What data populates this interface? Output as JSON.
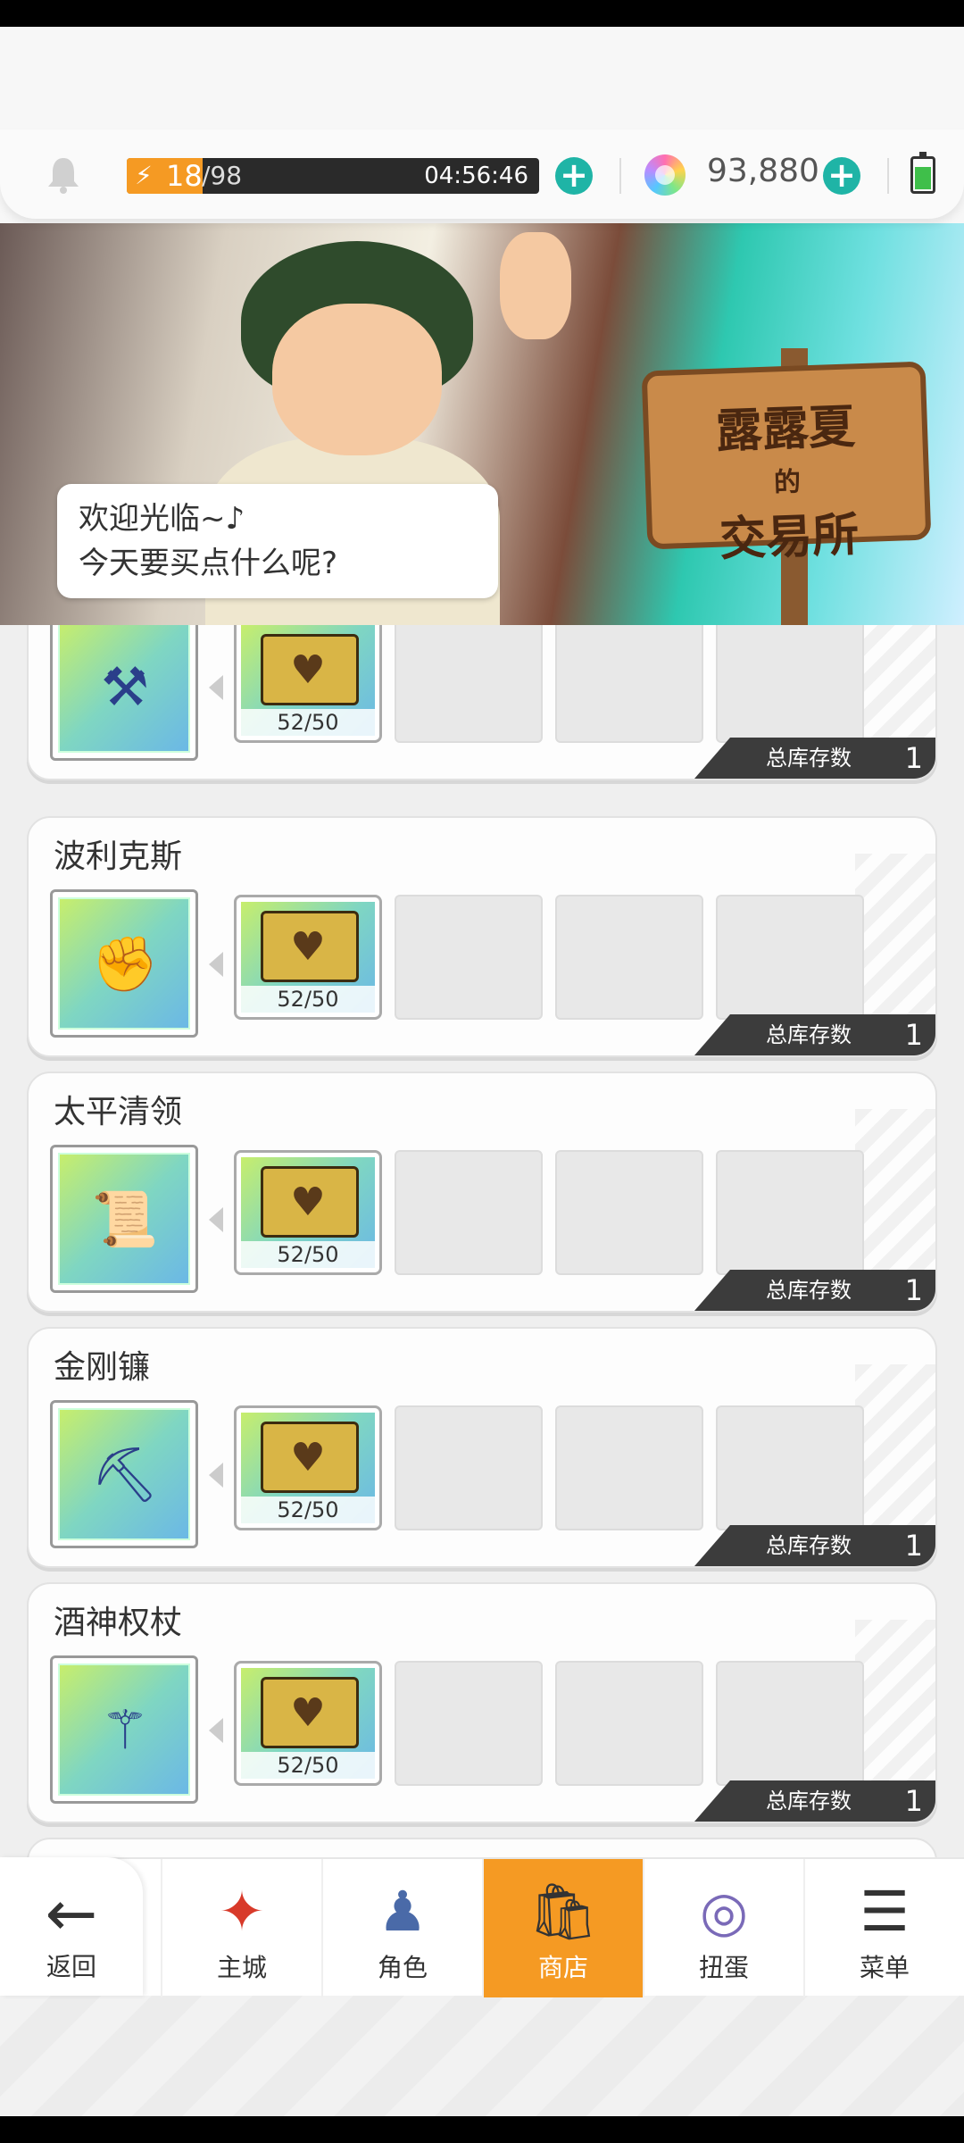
{
  "resources": {
    "energy_current": "18",
    "energy_max": "/98",
    "energy_fraction": 0.184,
    "energy_timer": "04:56:46",
    "gems": "93,880",
    "battery_level": 0.7
  },
  "banner": {
    "sign_line1": "露露夏",
    "sign_mid": "的",
    "sign_line2": "交易所",
    "greeting_line1": "欢迎光临~♪",
    "greeting_line2": "今天要买点什么呢?"
  },
  "shop_items": [
    {
      "name": "",
      "icon": "axe-icon",
      "glyph": "⚒",
      "material_count": "52/50",
      "stock_label": "总库存数",
      "stock": "1"
    },
    {
      "name": "波利克斯",
      "icon": "gauntlet-icon",
      "glyph": "✊",
      "material_count": "52/50",
      "stock_label": "总库存数",
      "stock": "1"
    },
    {
      "name": "太平清领",
      "icon": "scroll-icon",
      "glyph": "📜",
      "material_count": "52/50",
      "stock_label": "总库存数",
      "stock": "1"
    },
    {
      "name": "金刚镰",
      "icon": "scythe-icon",
      "glyph": "⛏",
      "material_count": "52/50",
      "stock_label": "总库存数",
      "stock": "1"
    },
    {
      "name": "酒神权杖",
      "icon": "staff-icon",
      "glyph": "⚚",
      "material_count": "52/50",
      "stock_label": "总库存数",
      "stock": "1"
    }
  ],
  "nav": {
    "back": "返回",
    "items": [
      {
        "label": "主城",
        "icon": "castle-icon",
        "glyph": "✦"
      },
      {
        "label": "角色",
        "icon": "character-icon",
        "glyph": "♟"
      },
      {
        "label": "商店",
        "icon": "shop-icon",
        "glyph": "🛍"
      },
      {
        "label": "扭蛋",
        "icon": "gacha-icon",
        "glyph": "◎"
      },
      {
        "label": "菜单",
        "icon": "menu-icon",
        "glyph": "☰"
      }
    ],
    "active": "商店"
  },
  "colors": {
    "accent": "#f59a23",
    "plus": "#1fb4a6",
    "stock_tab": "#3c3c3c"
  }
}
